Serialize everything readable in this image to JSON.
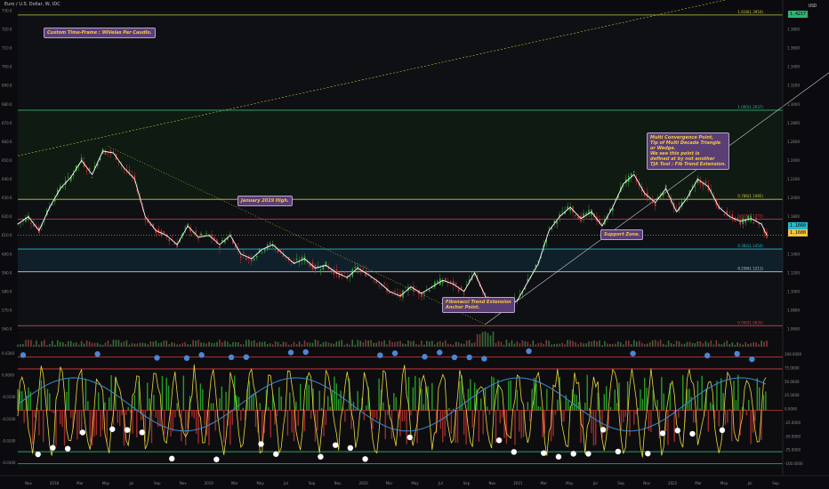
{
  "window": {
    "title": "Euro / U.S. Dollar, W, IDC",
    "currency": "USD"
  },
  "annotations": {
    "custom_tf": "Custom Time-Frame : 90Velas Per Caudlo.",
    "jan2019": "January 2019 High.",
    "fib_anchor": "Fibonacci Trend Extension\nAnchor Point.",
    "multi": "Multi Convergence Point,\nTip of Multi Decade Triangle\nor Wedge.\nWe see this point is\ndefined at by not another\nTJA Tool : Fib Trend Extension.",
    "support": "Support Zone."
  },
  "price_tags": {
    "current": "1.1600",
    "top": "1.4217",
    "mid1": "1.1660",
    "mid2": "1.1574"
  },
  "colors": {
    "bg": "#0b0b0f",
    "fib_green": "#2bb673",
    "fib_yellow": "#c8c83a",
    "fib_red": "#d64040",
    "fib_cyan": "#2bb8c8",
    "candle_up": "#3aa83a",
    "candle_down": "#c83232",
    "note_bg": "#5a3f74",
    "note_text": "#f5c542"
  },
  "chart_data": {
    "type": "line",
    "title": "Euro / U.S. Dollar, W, IDC",
    "xlabel": "",
    "ylabel": "USD",
    "x_ticks": [
      "Nov",
      "2018",
      "Mar",
      "May",
      "Jul",
      "Sep",
      "Nov",
      "2019",
      "Mar",
      "May",
      "Jul",
      "Sep",
      "Nov",
      "2020",
      "Mar",
      "May",
      "Jul",
      "Sep",
      "Nov",
      "2021",
      "Mar",
      "May",
      "Jul",
      "Sep",
      "Nov",
      "2022",
      "Mar",
      "May",
      "Jul",
      "Sep"
    ],
    "y_ticks_right": [
      "1.4217",
      "1.3800",
      "1.3600",
      "1.3400",
      "1.3200",
      "1.3000",
      "1.2800",
      "1.2600",
      "1.2400",
      "1.2200",
      "1.2000",
      "1.1800",
      "1.1600",
      "1.1400",
      "1.1200",
      "1.1000",
      "1.0800",
      "1.0600",
      "1.0400",
      "1.0200",
      "1.0000",
      "0.9800"
    ],
    "y_ticks_left": [
      "730.0",
      "720.0",
      "710.0",
      "700.0",
      "690.0",
      "680.0",
      "670.0",
      "660.0",
      "650.0",
      "640.0",
      "630.0",
      "620.0",
      "610.0",
      "600.0",
      "590.0",
      "580.0",
      "570.0",
      "560.0"
    ],
    "fib_levels": [
      {
        "label": "1.618(1.3954)",
        "price": 1.3954,
        "color": "#c8c83a"
      },
      {
        "label": "1.000(1.2937)",
        "price": 1.2937,
        "color": "#2bb673"
      },
      {
        "label": "0.786(1.1985)",
        "price": 1.1985,
        "color": "#c8c83a"
      },
      {
        "label": "0.618(1.1772)",
        "price": 1.1772,
        "color": "#d64040"
      },
      {
        "label": "0.382(1.1454)",
        "price": 1.1454,
        "color": "#2bb8c8"
      },
      {
        "label": "0.236(1.1211)",
        "price": 1.1211,
        "color": "#c8c8c8"
      },
      {
        "label": "0.000(1.0635)",
        "price": 1.0635,
        "color": "#d64040"
      }
    ],
    "series": [
      {
        "name": "EURUSD",
        "points": [
          [
            0,
            1.172
          ],
          [
            10,
            1.18
          ],
          [
            20,
            1.165
          ],
          [
            30,
            1.19
          ],
          [
            40,
            1.21
          ],
          [
            50,
            1.222
          ],
          [
            60,
            1.24
          ],
          [
            70,
            1.225
          ],
          [
            80,
            1.25
          ],
          [
            90,
            1.248
          ],
          [
            100,
            1.232
          ],
          [
            110,
            1.22
          ],
          [
            120,
            1.18
          ],
          [
            130,
            1.165
          ],
          [
            140,
            1.16
          ],
          [
            150,
            1.15
          ],
          [
            160,
            1.17
          ],
          [
            170,
            1.158
          ],
          [
            180,
            1.16
          ],
          [
            190,
            1.15
          ],
          [
            200,
            1.16
          ],
          [
            210,
            1.14
          ],
          [
            220,
            1.135
          ],
          [
            230,
            1.145
          ],
          [
            240,
            1.15
          ],
          [
            250,
            1.14
          ],
          [
            260,
            1.13
          ],
          [
            270,
            1.135
          ],
          [
            280,
            1.125
          ],
          [
            290,
            1.128
          ],
          [
            300,
            1.12
          ],
          [
            310,
            1.115
          ],
          [
            320,
            1.125
          ],
          [
            330,
            1.118
          ],
          [
            340,
            1.11
          ],
          [
            350,
            1.1
          ],
          [
            360,
            1.095
          ],
          [
            370,
            1.105
          ],
          [
            380,
            1.098
          ],
          [
            390,
            1.105
          ],
          [
            400,
            1.112
          ],
          [
            410,
            1.108
          ],
          [
            420,
            1.1
          ],
          [
            430,
            1.12
          ],
          [
            440,
            1.095
          ],
          [
            450,
            1.08
          ],
          [
            460,
            1.085
          ],
          [
            470,
            1.09
          ],
          [
            480,
            1.11
          ],
          [
            490,
            1.13
          ],
          [
            500,
            1.165
          ],
          [
            510,
            1.18
          ],
          [
            520,
            1.19
          ],
          [
            530,
            1.178
          ],
          [
            540,
            1.185
          ],
          [
            550,
            1.17
          ],
          [
            560,
            1.19
          ],
          [
            570,
            1.215
          ],
          [
            580,
            1.225
          ],
          [
            590,
            1.205
          ],
          [
            600,
            1.195
          ],
          [
            610,
            1.21
          ],
          [
            620,
            1.185
          ],
          [
            630,
            1.2
          ],
          [
            640,
            1.22
          ],
          [
            650,
            1.212
          ],
          [
            660,
            1.19
          ],
          [
            670,
            1.18
          ],
          [
            680,
            1.175
          ],
          [
            690,
            1.178
          ],
          [
            700,
            1.172
          ],
          [
            705,
            1.16
          ]
        ]
      }
    ],
    "oscillator": {
      "ylabel": "USD",
      "y_ticks": [
        "100.0000",
        "75.0000",
        "50.0000",
        "25.0000",
        "0.0000",
        "-25.0000",
        "-50.0000",
        "-75.0000",
        "-100.0000"
      ],
      "left_ticks": [
        "0.0300",
        "0.0000",
        "-0.0100",
        "-0.0100",
        "-0.0200",
        "-0.0300"
      ]
    }
  }
}
